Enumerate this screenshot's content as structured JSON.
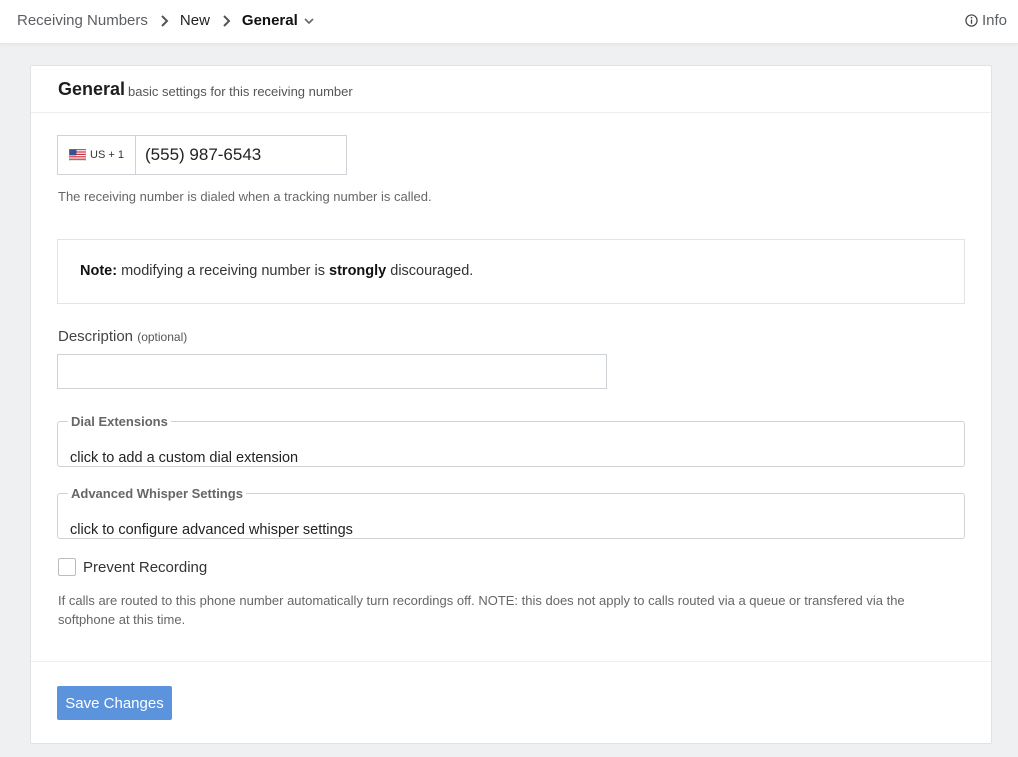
{
  "breadcrumb": {
    "root": "Receiving Numbers",
    "middle": "New",
    "current": "General"
  },
  "info_label": "Info",
  "section": {
    "title": "General",
    "subtitle": "basic settings for this receiving number"
  },
  "phone": {
    "country_code": "US + 1",
    "value": "(555) 987-6543"
  },
  "phone_helper": "The receiving number is dialed when a tracking number is called.",
  "note": {
    "label": "Note:",
    "text_before": " modifying a receiving number is ",
    "emphasis": "strongly",
    "text_after": " discouraged."
  },
  "description": {
    "label": "Description",
    "optional": "(optional)",
    "value": ""
  },
  "dial_extensions": {
    "legend": "Dial Extensions",
    "text": "click to add a custom dial extension"
  },
  "whisper": {
    "legend": "Advanced Whisper Settings",
    "text": "click to configure advanced whisper settings"
  },
  "prevent_recording": {
    "label": "Prevent Recording",
    "checked": false,
    "help": "If calls are routed to this phone number automatically turn recordings off. NOTE: this does not apply to calls routed via a queue or transfered via the softphone at this time."
  },
  "save_label": "Save Changes",
  "colors": {
    "primary_button": "#5b93dd",
    "background": "#eef0f2"
  },
  "icons": {
    "breadcrumb_separator": "chevron-right-icon",
    "dropdown": "chevron-down-icon",
    "info": "info-circle-icon",
    "flag": "us-flag-icon"
  }
}
